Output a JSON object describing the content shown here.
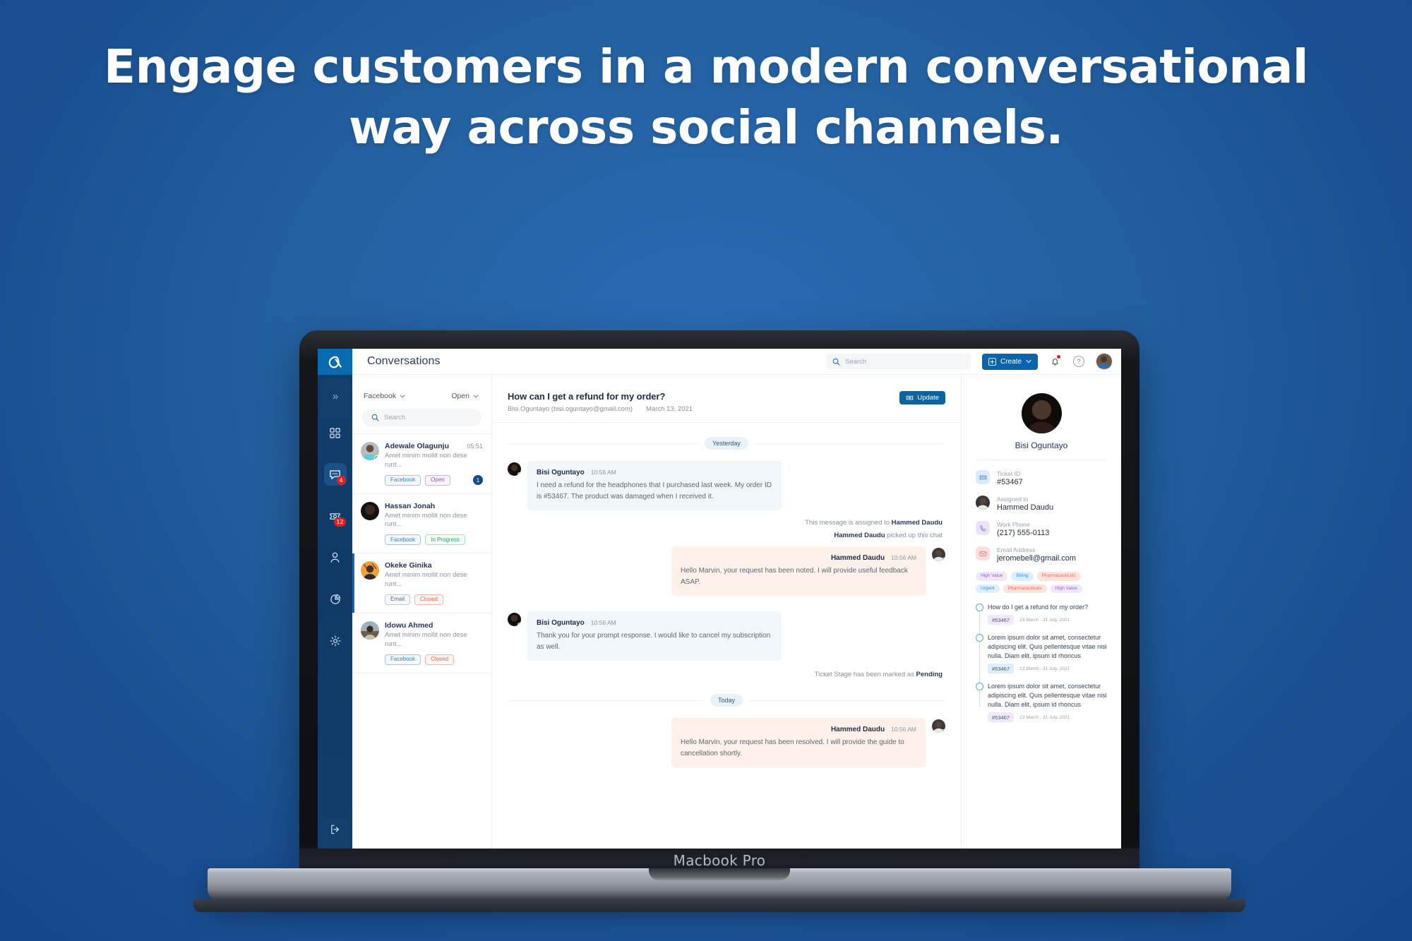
{
  "headline": {
    "line1": "Engage customers in a modern conversational",
    "line2": "way across social channels."
  },
  "device": {
    "model_label": "Macbook Pro"
  },
  "rail": {
    "logo": "alpha-logo-icon",
    "collapse_label": "»",
    "items": [
      {
        "name": "dashboard-icon",
        "badge": ""
      },
      {
        "name": "conversations-icon",
        "badge": "4",
        "active": true
      },
      {
        "name": "tickets-icon",
        "badge": "12"
      },
      {
        "name": "contacts-icon",
        "badge": ""
      },
      {
        "name": "reports-icon",
        "badge": ""
      },
      {
        "name": "settings-icon",
        "badge": ""
      }
    ],
    "logout": "logout-icon"
  },
  "topbar": {
    "title": "Conversations",
    "search_placeholder": "Search",
    "create_label": "Create",
    "notification_icon": "bell-icon",
    "help_icon": "question-mark-icon",
    "help_glyph": "?",
    "avatar": "user-avatar"
  },
  "conversation_list": {
    "channel_filter": "Facebook",
    "status_filter": "Open",
    "search_placeholder": "Search",
    "items": [
      {
        "name": "Adewale Olagunju",
        "time": "05:51",
        "snippet": "Amet minim mollit non dese runt...",
        "channel": "Facebook",
        "channel_class": "fb",
        "status": "Open",
        "status_class": "open",
        "unread": "1",
        "online": true,
        "selected": false,
        "avatar_color": "#a9b4b8"
      },
      {
        "name": "Hassan Jonah",
        "time": "",
        "snippet": "Amet minim mollit non dese runt...",
        "channel": "Facebook",
        "channel_class": "fb",
        "status": "In Progress",
        "status_class": "prog",
        "unread": "",
        "online": false,
        "selected": false,
        "avatar_color": "#1d1a18"
      },
      {
        "name": "Okeke Ginika",
        "time": "",
        "snippet": "Amet minim mollit non dese runt...",
        "channel": "Email",
        "channel_class": "email",
        "status": "Closed",
        "status_class": "closed",
        "unread": "",
        "online": false,
        "selected": true,
        "avatar_color": "#e8a33d"
      },
      {
        "name": "Idowu Ahmed",
        "time": "",
        "snippet": "Amet minim mollit non dese runt...",
        "channel": "Facebook",
        "channel_class": "fb",
        "status": "Closed",
        "status_class": "closed",
        "unread": "",
        "online": false,
        "selected": false,
        "avatar_color": "#8d9aa6"
      }
    ]
  },
  "chat": {
    "subject": "How can I get a refund for my order?",
    "from": "Bisi Oguntayo (bisi.oguntayo@gmail.com)",
    "date": "March 13, 2021",
    "update_label": "Update",
    "day_separator_1": "Yesterday",
    "day_separator_2": "Today",
    "messages": [
      {
        "kind": "inbound",
        "author": "Bisi Oguntayo",
        "time": "10:56 AM",
        "text": "I need a refund for the headphones that I purchased last week. My order ID is #53467. The product was damaged when I received it."
      },
      {
        "kind": "system",
        "text_prefix": "This message is assigned to ",
        "text_bold": "Hammed Daudu",
        "text_suffix": ""
      },
      {
        "kind": "system",
        "text_prefix": "",
        "text_bold": "Hammed Daudu",
        "text_suffix": " picked up this chat"
      },
      {
        "kind": "outbound",
        "author": "Hammed Daudu",
        "time": "10:56 AM",
        "text": "Hello Marvin, your request has been noted. I will provide useful feedback ASAP."
      },
      {
        "kind": "inbound",
        "author": "Bisi Oguntayo",
        "time": "10:56 AM",
        "text": "Thank you for your prompt response. I would like to cancel my subscription as well."
      },
      {
        "kind": "system",
        "text_prefix": "Ticket Stage has been marked as ",
        "text_bold": "Pending",
        "text_suffix": ""
      },
      {
        "kind": "outbound",
        "author": "Hammed Daudu",
        "time": "10:56 AM",
        "text": "Hello Marvin, your request has been resolved. I will provide the guide to cancellation shortly."
      }
    ]
  },
  "details": {
    "contact_name": "Bisi Oguntayo",
    "fields": [
      {
        "icon": "ticket-icon",
        "icon_class": "ticket",
        "label": "Ticket ID",
        "value": "#53467"
      },
      {
        "icon": "assignee-avatar",
        "icon_class": "ava",
        "label": "Assigned to",
        "value": "Hammed Daudu"
      },
      {
        "icon": "phone-icon",
        "icon_class": "phone",
        "label": "Work Phone",
        "value": "(217) 555-0113"
      },
      {
        "icon": "mail-icon",
        "icon_class": "mail",
        "label": "Email Address",
        "value": "jeromebell@gmail.com"
      }
    ],
    "tags": [
      {
        "label": "High Value",
        "cls": "hv"
      },
      {
        "label": "Billing",
        "cls": "bill"
      },
      {
        "label": "Pharmaceuticals",
        "cls": "ph"
      },
      {
        "label": "Urgent",
        "cls": "urg"
      },
      {
        "label": "Pharmaceuticals",
        "cls": "ph"
      },
      {
        "label": "High Value",
        "cls": "hv"
      }
    ],
    "timeline": [
      {
        "text": "How do I get a refund for my order?",
        "id": "#53467",
        "id_cls": "p",
        "date": "13 March - 31 July, 2021"
      },
      {
        "text": "Lorem ipsum dolor sit amet, consectetur adipiscing elit. Quis pellentesque vitae nisi nulla. Diam elit, ipsum id rhoncus",
        "id": "#53467",
        "id_cls": "b",
        "date": "13 March - 31 July, 2021"
      },
      {
        "text": "Lorem ipsum dolor sit amet, consectetur adipiscing elit. Quis pellentesque vitae nisi nulla. Diam elit, ipsum id rhoncus",
        "id": "#53467",
        "id_cls": "p",
        "date": "13 March - 31 July, 2021"
      }
    ]
  },
  "colors": {
    "brand_blue": "#0a64ac",
    "rail_navy": "#123f6d",
    "page_bg": "#1b5ba8",
    "accent_red": "#e02020",
    "online_green": "#27c24c"
  }
}
